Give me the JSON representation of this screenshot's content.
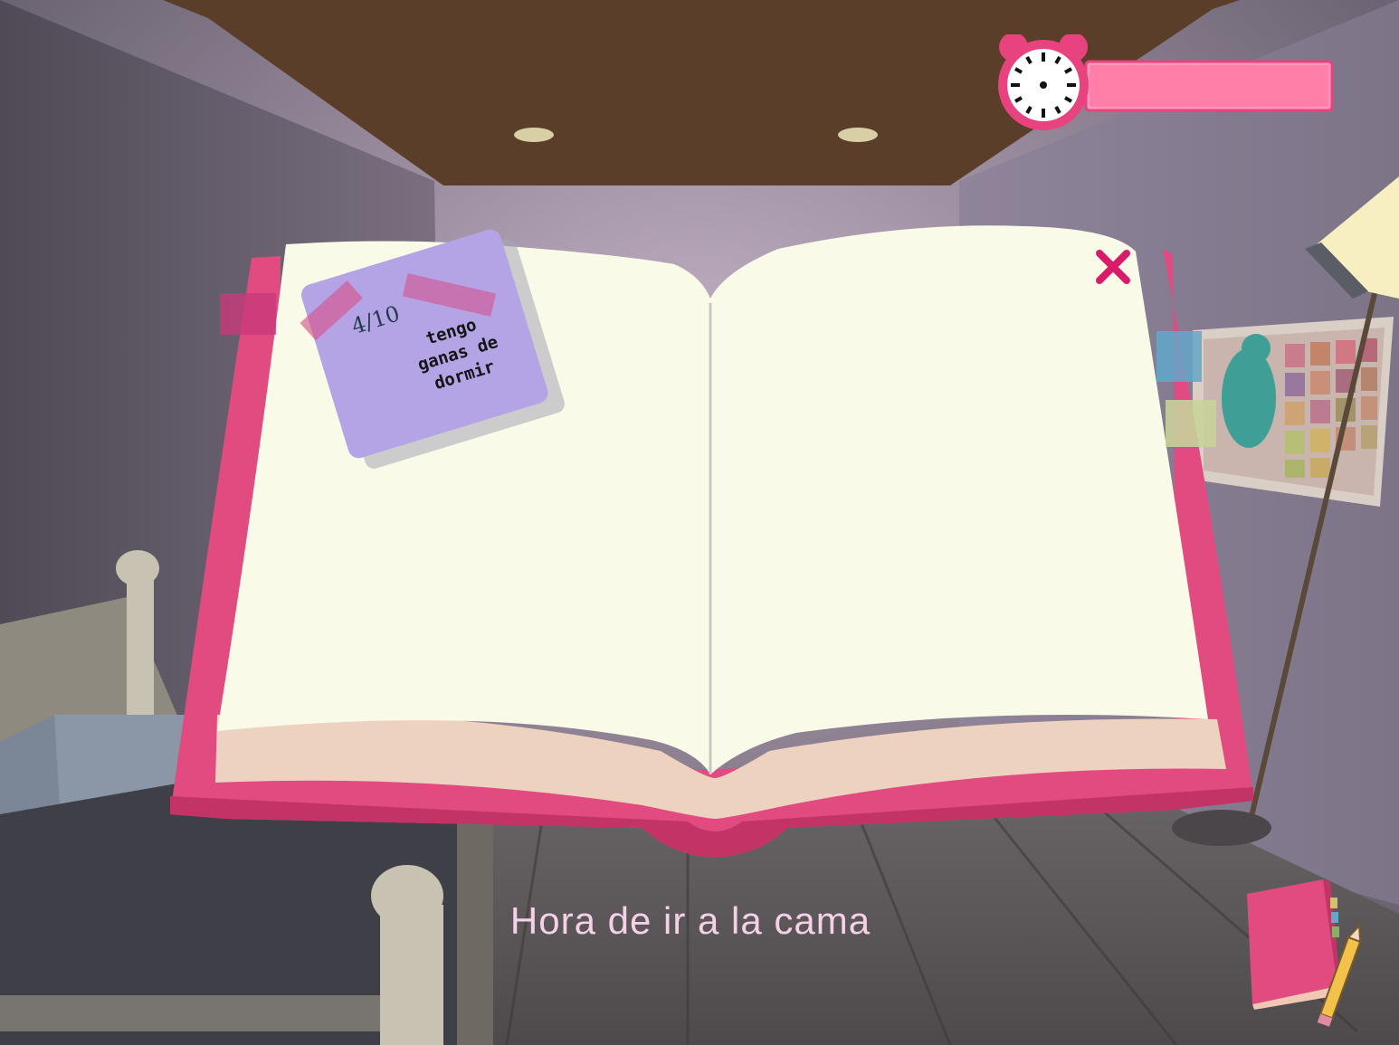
{
  "hud": {
    "clock_icon": "alarm-clock-icon",
    "time_bar_fill": 1.0,
    "time_bar_color": "#ff7fa8",
    "clock_color": "#e8437e"
  },
  "notebook": {
    "close_icon": "close-icon",
    "cover_color": "#e24b80",
    "page_color": "#fafae9",
    "sticky_note": {
      "counter": "4/10",
      "text": "tengo\nganas de\ndormir",
      "color": "#b4a4e6"
    }
  },
  "subtitle": "Hora de ir a la cama",
  "journal_button": {
    "icon": "journal-pencil-icon",
    "color": "#e24b80"
  }
}
